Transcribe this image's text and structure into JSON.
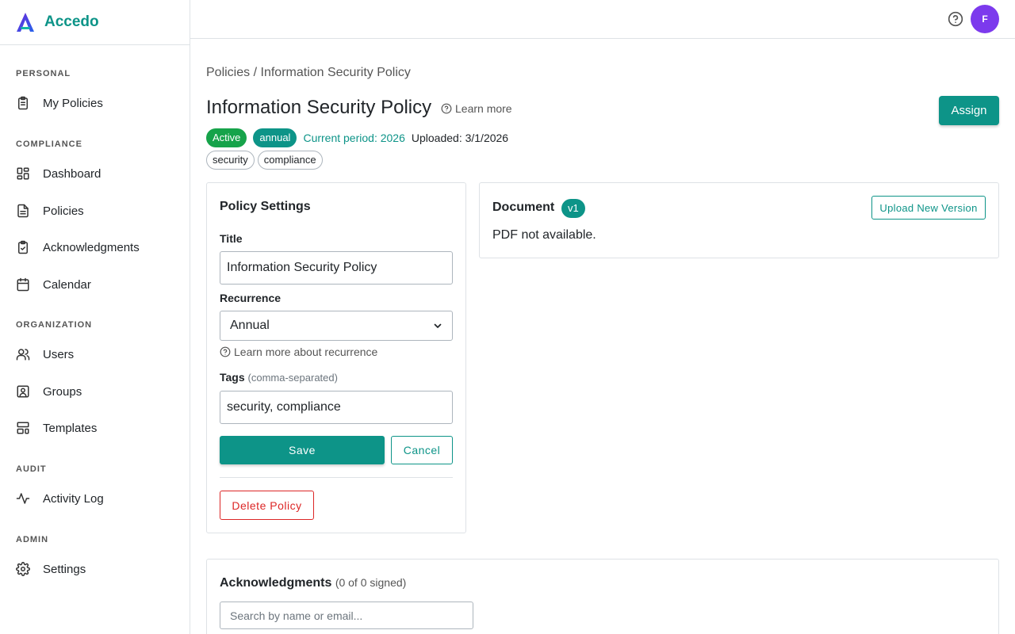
{
  "app": {
    "name": "Accedo"
  },
  "sidebar": {
    "sections": [
      {
        "label": "PERSONAL",
        "items": [
          {
            "label": "My Policies",
            "icon": "clipboard-list-icon"
          }
        ]
      },
      {
        "label": "COMPLIANCE",
        "items": [
          {
            "label": "Dashboard",
            "icon": "dashboard-grid-icon"
          },
          {
            "label": "Policies",
            "icon": "document-icon"
          },
          {
            "label": "Acknowledgments",
            "icon": "clipboard-check-icon"
          },
          {
            "label": "Calendar",
            "icon": "calendar-icon"
          }
        ]
      },
      {
        "label": "ORGANIZATION",
        "items": [
          {
            "label": "Users",
            "icon": "users-icon"
          },
          {
            "label": "Groups",
            "icon": "contact-card-icon"
          },
          {
            "label": "Templates",
            "icon": "template-layout-icon"
          }
        ]
      },
      {
        "label": "AUDIT",
        "items": [
          {
            "label": "Activity Log",
            "icon": "activity-pulse-icon"
          }
        ]
      },
      {
        "label": "ADMIN",
        "items": [
          {
            "label": "Settings",
            "icon": "gear-icon"
          }
        ]
      }
    ]
  },
  "topbar": {
    "avatar_initial": "F",
    "avatar_color": "#7c3aed"
  },
  "breadcrumb": {
    "parent": "Policies",
    "separator": "/",
    "current": "Information Security Policy"
  },
  "page": {
    "title": "Information Security Policy",
    "learn_more": "Learn more",
    "assign_label": "Assign",
    "status": "Active",
    "frequency": "annual",
    "period": "Current period: 2026",
    "uploaded": "Uploaded: 3/1/2026",
    "tags": [
      "security",
      "compliance"
    ]
  },
  "settings": {
    "heading": "Policy Settings",
    "title_label": "Title",
    "title_value": "Information Security Policy",
    "recurrence_label": "Recurrence",
    "recurrence_value": "Annual",
    "recurrence_help": "Learn more about recurrence",
    "tags_label": "Tags",
    "tags_hint": "(comma-separated)",
    "tags_value": "security, compliance",
    "save_label": "Save",
    "cancel_label": "Cancel",
    "delete_label": "Delete Policy"
  },
  "document": {
    "heading": "Document",
    "version": "v1",
    "upload_label": "Upload New Version",
    "message": "PDF not available."
  },
  "acknowledgments": {
    "heading": "Acknowledgments",
    "count": "(0 of 0 signed)",
    "search_placeholder": "Search by name or email..."
  },
  "colors": {
    "accent": "#0d9488",
    "active": "#16a34a",
    "danger": "#dc2626"
  }
}
